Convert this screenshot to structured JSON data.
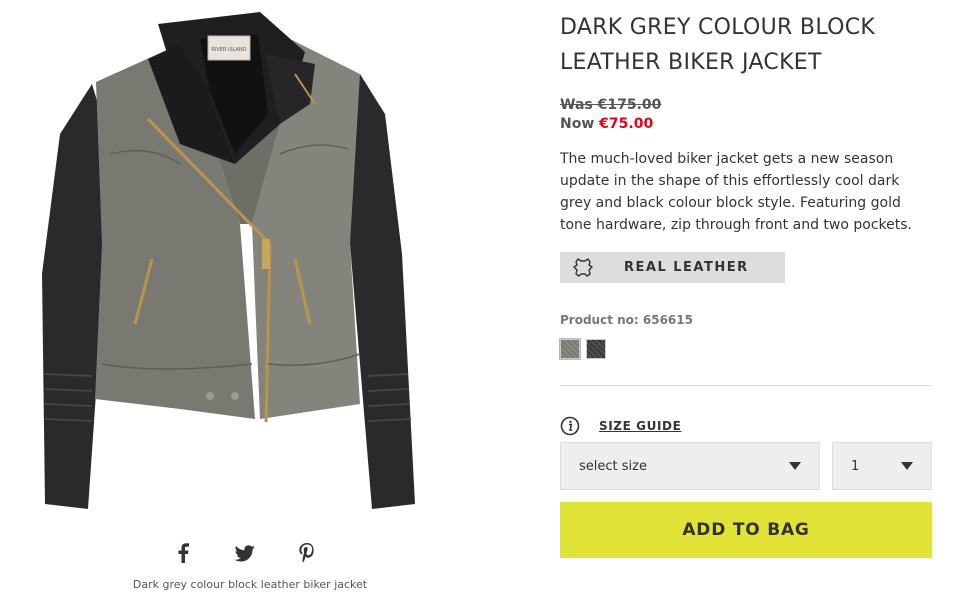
{
  "product": {
    "title": "DARK GREY COLOUR BLOCK LEATHER BIKER JACKET",
    "price_was_label": "Was €175.00",
    "price_now_prefix": "Now ",
    "price_now_amount": "€75.00",
    "description": "The much-loved biker jacket gets a new season update in the shape of this effortlessly cool dark grey and black colour block style. Featuring gold tone hardware, zip through front and two pockets.",
    "badge_label": "REAL LEATHER",
    "product_no": "Product no: 656615",
    "image_caption": "Dark grey colour block leather biker jacket",
    "label_tag_text": "RIVER ISLAND"
  },
  "swatches": [
    {
      "name": "dark grey",
      "color": "#7f7e76"
    },
    {
      "name": "black",
      "color": "#454545"
    }
  ],
  "size_guide_label": "SIZE GUIDE",
  "size_select": {
    "value": "select size"
  },
  "qty_select": {
    "value": "1"
  },
  "add_to_bag_label": "ADD TO BAG",
  "share_icons": [
    "facebook-icon",
    "twitter-icon",
    "pinterest-icon"
  ],
  "colors": {
    "accent_button": "#e2e337",
    "sale_price": "#e3001b",
    "badge_bg": "#dedddb"
  }
}
